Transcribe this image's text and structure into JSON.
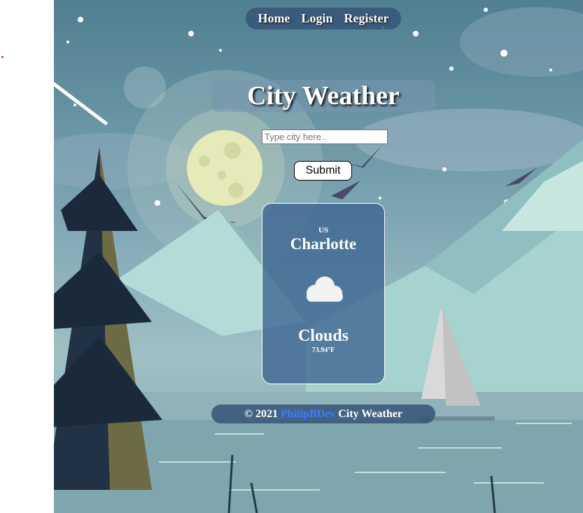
{
  "nav": {
    "items": [
      {
        "label": "Home"
      },
      {
        "label": "Login"
      },
      {
        "label": "Register"
      }
    ]
  },
  "title": "City Weather",
  "search": {
    "placeholder": "Type city here..",
    "value": ""
  },
  "submit_label": "Submit",
  "card": {
    "country": "US",
    "city": "Charlotte",
    "icon": "cloud-icon",
    "condition": "Clouds",
    "temperature": "73.94°F"
  },
  "footer": {
    "copyright": "© 2021",
    "author": "PhilipBDev",
    "app_name": "City Weather"
  },
  "colors": {
    "nav_bg": "#375578",
    "card_bg": "#3c6491",
    "link": "#3d7bff"
  }
}
